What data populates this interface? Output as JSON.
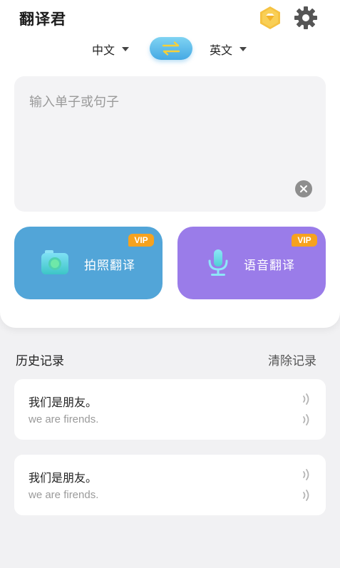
{
  "app": {
    "title": "翻译君"
  },
  "header": {
    "vip_icon": "diamond-badge-icon",
    "settings_icon": "gear-icon"
  },
  "languages": {
    "source": "中文",
    "target": "英文"
  },
  "input": {
    "placeholder": "输入单子或句子",
    "value": ""
  },
  "features": {
    "photo": {
      "label": "拍照翻译",
      "tag": "VIP",
      "color": "#52a5d8"
    },
    "voice": {
      "label": "语音翻译",
      "tag": "VIP",
      "color": "#9a7ce9"
    }
  },
  "history": {
    "title": "历史记录",
    "clear_label": "清除记录",
    "items": [
      {
        "source": "我们是朋友。",
        "target": "we are firends."
      },
      {
        "source": "我们是朋友。",
        "target": "we are firends."
      }
    ]
  },
  "colors": {
    "accent": "#45a9e4",
    "vip": "#f6a21e",
    "badge": "#f5c242"
  }
}
